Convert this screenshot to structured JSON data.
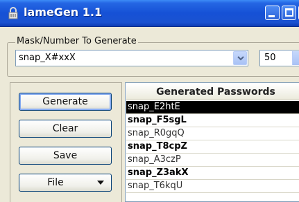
{
  "window": {
    "title": "lameGen 1.1",
    "icon": "lock-icon"
  },
  "mask_group": {
    "legend": "Mask/Number To Generate",
    "mask_value": "snap_X#xxX",
    "count_value": "50"
  },
  "buttons": {
    "generate": "Generate",
    "clear": "Clear",
    "save": "Save",
    "file": "File"
  },
  "passwords": {
    "header": "Generated Passwords",
    "items": [
      {
        "text": "snap_E2htE"
      },
      {
        "text": "snap_F5sgL"
      },
      {
        "text": "snap_R0gqQ"
      },
      {
        "text": "snap_T8cpZ"
      },
      {
        "text": "snap_A3czP"
      },
      {
        "text": "snap_Z3akX"
      },
      {
        "text": "snap_T6kqU"
      }
    ]
  },
  "colors": {
    "titlebar": "#1651d6",
    "selection": "#000000",
    "button_border": "#003c74"
  }
}
